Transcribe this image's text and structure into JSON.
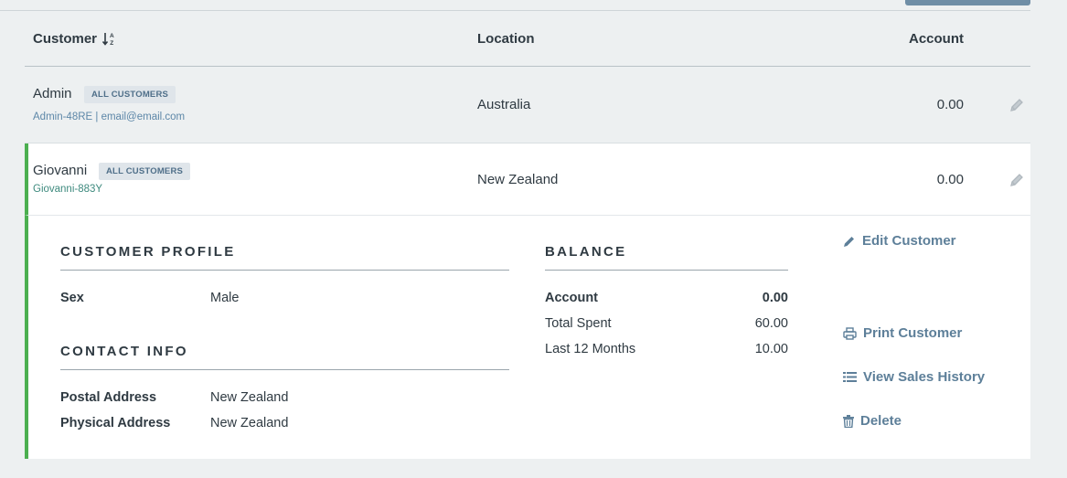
{
  "table": {
    "headers": {
      "customer": "Customer",
      "location": "Location",
      "account": "Account"
    },
    "rows": [
      {
        "name": "Admin",
        "badge": "ALL CUSTOMERS",
        "sub": "Admin-48RE | email@email.com",
        "location": "Australia",
        "account": "0.00"
      },
      {
        "name": "Giovanni",
        "badge": "ALL CUSTOMERS",
        "sub": "Giovanni-883Y",
        "location": "New Zealand",
        "account": "0.00"
      }
    ]
  },
  "detail": {
    "profile": {
      "title": "CUSTOMER PROFILE",
      "fields": [
        {
          "label": "Sex",
          "value": "Male"
        }
      ]
    },
    "contact": {
      "title": "CONTACT INFO",
      "fields": [
        {
          "label": "Postal Address",
          "value": "New Zealand"
        },
        {
          "label": "Physical Address",
          "value": "New Zealand"
        }
      ]
    },
    "balance": {
      "title": "BALANCE",
      "fields": [
        {
          "label": "Account",
          "value": "0.00"
        },
        {
          "label": "Total Spent",
          "value": "60.00"
        },
        {
          "label": "Last 12 Months",
          "value": "10.00"
        }
      ]
    },
    "actions": {
      "edit": "Edit Customer",
      "print": "Print Customer",
      "history": "View Sales History",
      "delete": "Delete"
    }
  },
  "colors": {
    "accent_green": "#4caf50",
    "link_blue": "#5d7f99",
    "badge_bg": "#dfe5ea",
    "page_bg": "#edf0f1"
  },
  "icons": [
    "sort-alpha-icon",
    "pencil-icon",
    "print-icon",
    "list-icon",
    "trash-icon"
  ]
}
